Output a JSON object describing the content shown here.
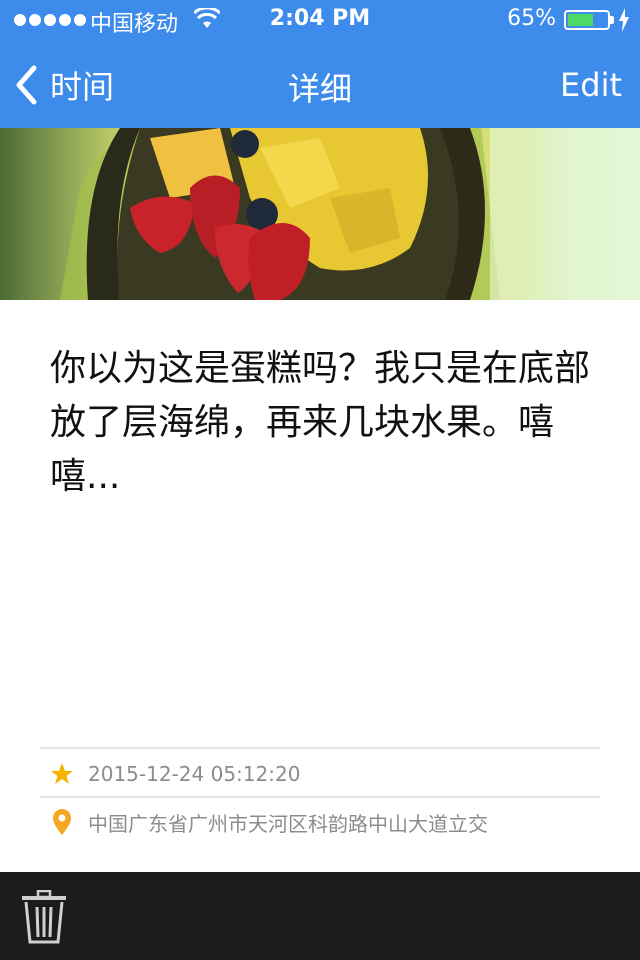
{
  "status_bar": {
    "carrier": "中国移动",
    "time": "2:04 PM",
    "battery_percent": "65%",
    "battery_level": 0.65
  },
  "nav": {
    "back_label": "时间",
    "title": "详细",
    "edit_label": "Edit"
  },
  "photo": {
    "description_icon": "cake-photo"
  },
  "note": {
    "text": "你以为这是蛋糕吗？我只是在底部放了层海绵，再来几块水果。嘻嘻..."
  },
  "info": {
    "timestamp": "2015-12-24 05:12:20",
    "location": "中国广东省广州市天河区科韵路中山大道立交"
  },
  "colors": {
    "header": "#3d8bea",
    "toolbar": "#1b1b1b",
    "star": "#f5b300",
    "pin": "#f5a623"
  }
}
